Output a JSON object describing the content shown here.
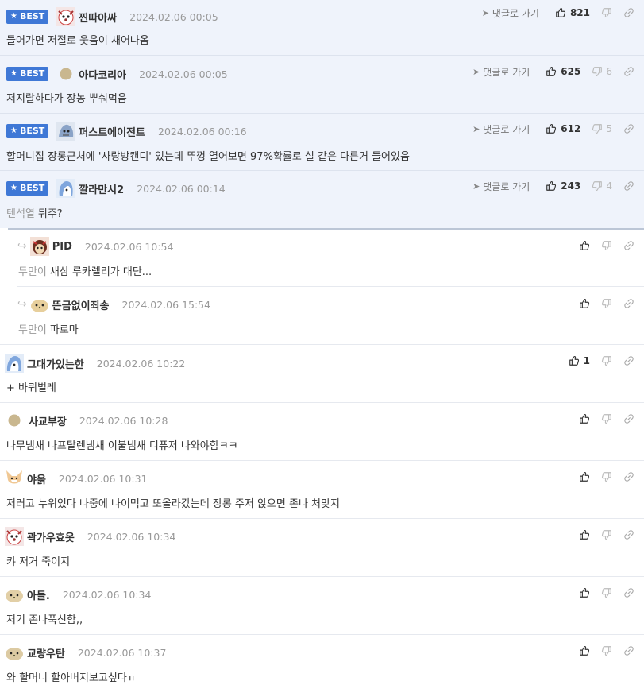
{
  "labels": {
    "best": "BEST",
    "goto_reply": "댓글로 가기"
  },
  "comments": [
    {
      "nick": "찐따아싸",
      "date": "2024.02.06 00:05",
      "text": "들어가면 저절로 웃음이 새어나옴",
      "likes": "821",
      "dislikes": ""
    },
    {
      "nick": "아다코리아",
      "date": "2024.02.06 00:05",
      "text": "저지랄하다가 장농 뿌숴먹음",
      "likes": "625",
      "dislikes": "6"
    },
    {
      "nick": "퍼스트에이전트",
      "date": "2024.02.06 00:16",
      "text": "할머니집 장롱근처에 '사랑방캔디' 있는데 뚜껑 열어보면 97%확률로 실 같은 다른거 들어있음",
      "likes": "612",
      "dislikes": "5"
    },
    {
      "nick": "깔라만시2",
      "date": "2024.02.06 00:14",
      "mention": "텐석열",
      "text": "뒤주?",
      "likes": "243",
      "dislikes": "4"
    },
    {
      "nick": "PID",
      "date": "2024.02.06 10:54",
      "mention": "두만이",
      "text": "새삼 루카렐리가 대단..."
    },
    {
      "nick": "뜬금없이죄송",
      "date": "2024.02.06 15:54",
      "mention": "두만이",
      "text": "파로마"
    },
    {
      "nick": "그대가있는한",
      "date": "2024.02.06 10:22",
      "text": "+ 바퀴벌레",
      "likes": "1"
    },
    {
      "nick": "사교부장",
      "date": "2024.02.06 10:28",
      "text": "나무냄새 나프탈렌냄새 이불냄새 디퓨저 나와야함ㅋㅋ"
    },
    {
      "nick": "야옭",
      "date": "2024.02.06 10:31",
      "text": "저러고 누워있다 나중에 나이먹고 또올라갔는데 장롱 주저 앉으면 존나 처맞지"
    },
    {
      "nick": "곽가우효옷",
      "date": "2024.02.06 10:34",
      "text": "캬 저거 죽이지"
    },
    {
      "nick": "아돌.",
      "date": "2024.02.06 10:34",
      "text": "저기 존나푹신함,,"
    },
    {
      "nick": "교량우탄",
      "date": "2024.02.06 10:37",
      "text": "와 할머니 할아버지보고싶다ㅠ"
    }
  ],
  "colors": {
    "best_bg": "#eff3fb",
    "badge": "#3f78d6",
    "mention": "#999999"
  },
  "icons": {
    "like": "thumbs-up-icon",
    "dislike": "thumbs-down-icon",
    "share": "link-icon",
    "goto": "send-arrow-icon",
    "reply": "reply-arrow-icon"
  }
}
